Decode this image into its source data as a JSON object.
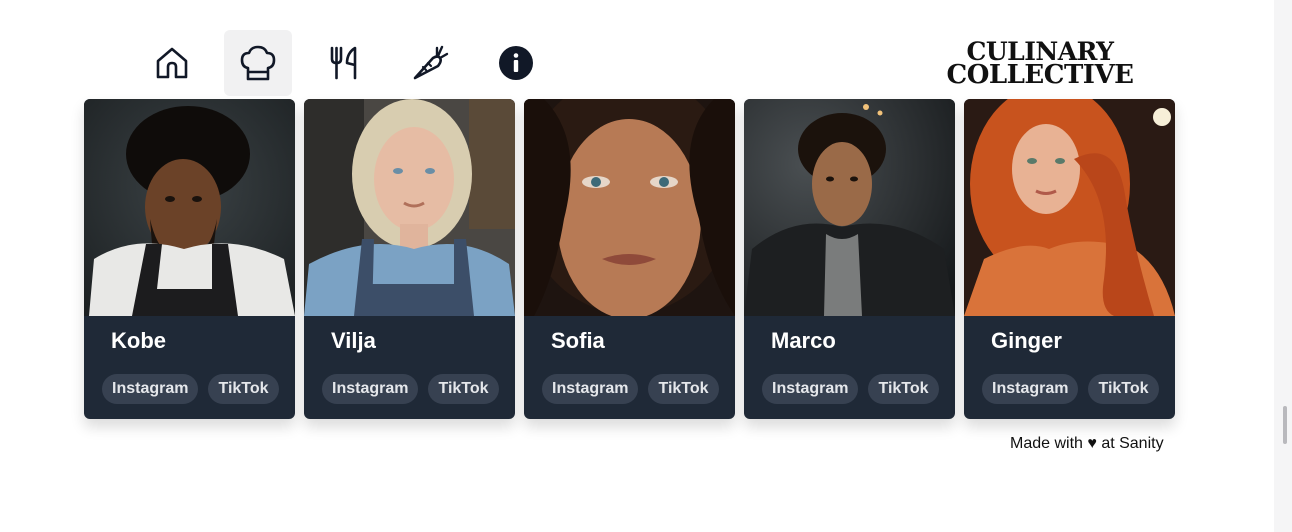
{
  "nav": {
    "items": [
      {
        "icon": "home-icon"
      },
      {
        "icon": "chef-hat-icon",
        "active": true
      },
      {
        "icon": "fork-knife-icon"
      },
      {
        "icon": "carrot-icon"
      },
      {
        "icon": "info-icon"
      }
    ]
  },
  "logo": {
    "line1": "CULINARY",
    "line2": "COLLECTIVE"
  },
  "chefs": [
    {
      "name": "Kobe",
      "instagram": "Instagram",
      "tiktok": "TikTok"
    },
    {
      "name": "Vilja",
      "instagram": "Instagram",
      "tiktok": "TikTok"
    },
    {
      "name": "Sofia",
      "instagram": "Instagram",
      "tiktok": "TikTok"
    },
    {
      "name": "Marco",
      "instagram": "Instagram",
      "tiktok": "TikTok"
    },
    {
      "name": "Ginger",
      "instagram": "Instagram",
      "tiktok": "TikTok"
    }
  ],
  "footer": {
    "text": "Made with ♥ at Sanity"
  },
  "colors": {
    "card_bg": "#1f2937",
    "pill_bg": "#374151",
    "nav_active_bg": "#f1f1f2"
  }
}
